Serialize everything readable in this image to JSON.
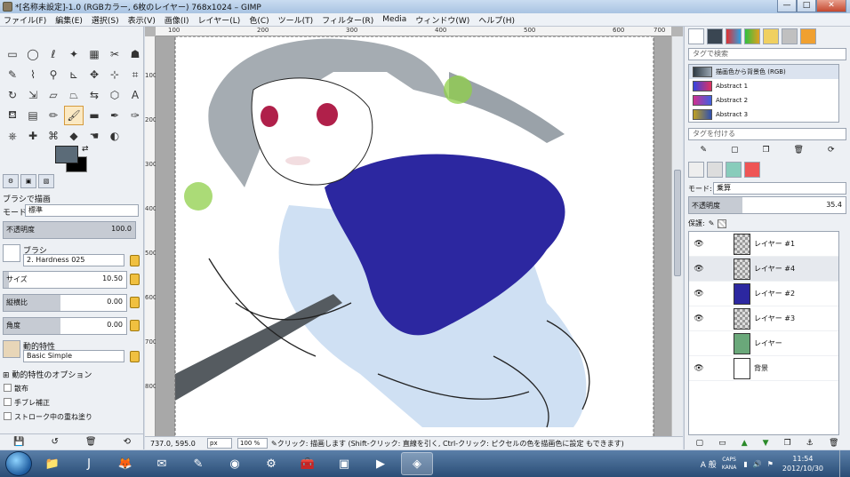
{
  "window": {
    "title": "*[名称未設定]-1.0 (RGBカラー, 6枚のレイヤー) 768x1024 – GIMP",
    "minimize": "—",
    "maximize": "□",
    "close": "✕"
  },
  "menu": [
    "ファイル(F)",
    "編集(E)",
    "選択(S)",
    "表示(V)",
    "画像(I)",
    "レイヤー(L)",
    "色(C)",
    "ツール(T)",
    "フィルター(R)",
    "Media",
    "ウィンドウ(W)",
    "ヘルプ(H)"
  ],
  "tool_options": {
    "header": "ブラシで描画",
    "mode_label": "モード:",
    "mode_value": "標準",
    "opacity_label": "不透明度",
    "opacity_value": "100.0",
    "brush_label": "ブラシ",
    "brush_name": "2. Hardness 025",
    "size_label": "サイズ",
    "size_value": "10.50",
    "aspect_label": "縦横比",
    "aspect_value": "0.00",
    "angle_label": "角度",
    "angle_value": "0.00",
    "dynamics_label": "動的特性",
    "dynamics_value": "Basic Simple",
    "dynamics_options": "動的特性のオプション",
    "scatter": "散布",
    "jitter": "手ブレ補正",
    "incremental": "ストローク中の重ね塗り"
  },
  "canvas": {
    "ruler_h": [
      "100",
      "200",
      "300",
      "400",
      "500",
      "600",
      "700"
    ],
    "ruler_v": [
      "100",
      "200",
      "300",
      "400",
      "500",
      "600",
      "700",
      "800"
    ]
  },
  "status": {
    "coords": "737.0, 595.0",
    "unit": "px",
    "zoom": "100 %",
    "message": "クリック: 描画します (Shift-クリック: 直線を引く, Ctrl-クリック: ピクセルの色を描画色に設定 もできます)"
  },
  "gradients": {
    "filter_placeholder": "タグで検索",
    "items": [
      {
        "name": "描画色から背景色 (RGB)",
        "from": "#2e3a44",
        "to": "#9aa6b2"
      },
      {
        "name": "Abstract 1",
        "from": "#3444e0",
        "to": "#e03060"
      },
      {
        "name": "Abstract 2",
        "from": "#d03090",
        "to": "#4060e0"
      },
      {
        "name": "Abstract 3",
        "from": "#c0a020",
        "to": "#3050b0"
      }
    ],
    "tag_placeholder": "タグを付ける"
  },
  "layers": {
    "mode_label": "モード:",
    "mode_value": "乗算",
    "opacity_label": "不透明度",
    "opacity_value": "35.4",
    "lock_label": "保護:",
    "items": [
      {
        "name": "レイヤー #1"
      },
      {
        "name": "レイヤー #4"
      },
      {
        "name": "レイヤー #2"
      },
      {
        "name": "レイヤー #3"
      },
      {
        "name": "レイヤー"
      },
      {
        "name": "背景"
      }
    ]
  },
  "taskbar": {
    "ime": "A 般",
    "caps": "CAPS",
    "kana": "KANA",
    "time": "11:54",
    "date": "2012/10/30"
  }
}
